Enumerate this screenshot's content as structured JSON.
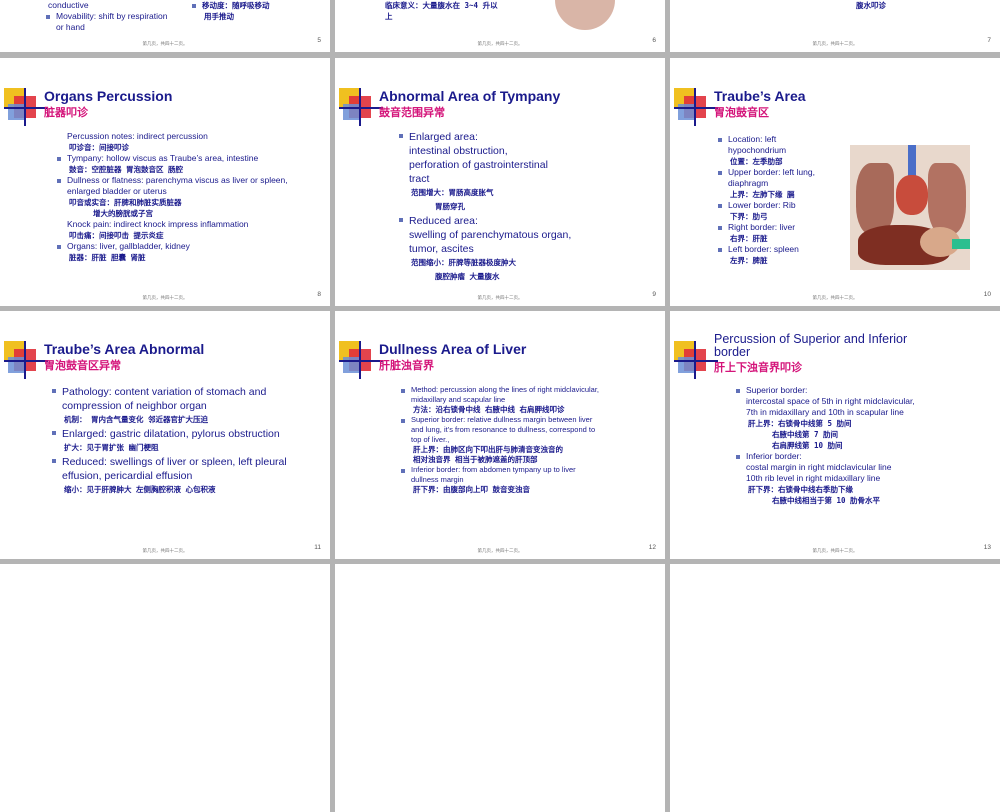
{
  "row0": {
    "s5": {
      "left_lines": [
        "conductive"
      ],
      "bullet": "Movability: shift by respiration or hand",
      "cn_lines": [
        "移动度：随呼吸移动",
        "用手推动"
      ],
      "page": "5"
    },
    "s6": {
      "lines": [
        "临床意义：大量腹水在 3~4 升以",
        "上"
      ],
      "page": "6"
    },
    "s7": {
      "lines": [
        "腹水叩诊"
      ],
      "page": "7"
    }
  },
  "footer_text": "第几页，共四十二页。",
  "s8": {
    "title": "Organs Percussion",
    "subtitle": "脏器叩诊",
    "lines": [
      {
        "t": "Percussion notes: indirect percussion",
        "k": "plain"
      },
      {
        "t": "叩诊音：间接叩诊",
        "k": "cn"
      },
      {
        "t": "Tympany: hollow viscus as Traube’s area, intestine",
        "k": "bullet"
      },
      {
        "t": "鼓音：空腔脏器 胃泡鼓音区 肠腔",
        "k": "cn"
      },
      {
        "t": "Dullness or flatness: parenchyma viscus as liver or spleen, enlarged bladder or uterus",
        "k": "bullet"
      },
      {
        "t": "叩音或实音：肝脾和肺脏实质脏器",
        "k": "cn"
      },
      {
        "t": "增大的膀胱或子宫",
        "k": "cn2"
      },
      {
        "t": "Knock pain: indirect knock impress inflammation",
        "k": "plain"
      },
      {
        "t": "叩击痛：间接叩击 提示炎症",
        "k": "cn"
      },
      {
        "t": "Organs: liver, gallbladder, kidney",
        "k": "bullet"
      },
      {
        "t": "脏器：肝脏 胆囊 肾脏",
        "k": "cn"
      }
    ],
    "page": "8"
  },
  "s9": {
    "title": "Abnormal Area of Tympany",
    "subtitle": "鼓音范围异常",
    "lines": [
      {
        "t": "Enlarged area:",
        "k": "bullet"
      },
      {
        "t": "intestinal obstruction,",
        "k": "plain"
      },
      {
        "t": "perforation of gastrointerstinal",
        "k": "plain"
      },
      {
        "t": "tract",
        "k": "plain"
      },
      {
        "t": "范围增大：胃肠高度胀气",
        "k": "cn"
      },
      {
        "t": "胃肠穿孔",
        "k": "cn2"
      },
      {
        "t": "Reduced area:",
        "k": "bullet"
      },
      {
        "t": "swelling of parenchymatous organ,",
        "k": "plain"
      },
      {
        "t": "tumor, ascites",
        "k": "plain"
      },
      {
        "t": "范围缩小：肝脾等脏器极度肿大",
        "k": "cn"
      },
      {
        "t": "腹腔肿瘤 大量腹水",
        "k": "cn2"
      }
    ],
    "page": "9"
  },
  "s10": {
    "title": "Traube’s Area",
    "subtitle": "胃泡鼓音区",
    "lines": [
      {
        "t": "Location: left hypochondrium",
        "k": "bullet"
      },
      {
        "t": "位置：左季肋部",
        "k": "cn"
      },
      {
        "t": "Upper border: left lung, diaphragm",
        "k": "bullet"
      },
      {
        "t": "上界：左肺下缘 膈",
        "k": "cn"
      },
      {
        "t": "Lower border: Rib",
        "k": "bullet"
      },
      {
        "t": "下界：肋弓",
        "k": "cn"
      },
      {
        "t": "Right border: liver",
        "k": "bullet"
      },
      {
        "t": "右界：肝脏",
        "k": "cn"
      },
      {
        "t": "Left border: spleen",
        "k": "bullet"
      },
      {
        "t": "左界：脾脏",
        "k": "cn"
      }
    ],
    "page": "10"
  },
  "s11": {
    "title": "Traube’s Area  Abnormal",
    "subtitle": "胃泡鼓音区异常",
    "lines": [
      {
        "t": "Pathology: content variation of stomach and compression of neighbor organ",
        "k": "bullet"
      },
      {
        "t": "机制： 胃内含气量变化 邻近器官扩大压迫",
        "k": "cn"
      },
      {
        "t": "Enlarged: gastric dilatation, pylorus obstruction",
        "k": "bullet"
      },
      {
        "t": "扩大：见于胃扩张 幽门梗阻",
        "k": "cn"
      },
      {
        "t": "Reduced: swellings of liver or spleen, left pleural effusion, pericardial effusion",
        "k": "bullet"
      },
      {
        "t": "缩小：见于肝脾肿大 左侧胸腔积液 心包积液",
        "k": "cn"
      }
    ],
    "page": "11"
  },
  "s12": {
    "title": "Dullness Area of Liver",
    "subtitle": "肝脏浊音界",
    "lines": [
      {
        "t": "Method: percussion along the lines of  right midclavicular, midaxillary and scapular line",
        "k": "bullet"
      },
      {
        "t": "方法：沿右锁骨中线 右腋中线 右肩胛线叩诊",
        "k": "cn"
      },
      {
        "t": "Superior border: relative dullness margin between liver and lung, it’s from resonance to dullness, correspond to top of liver.,",
        "k": "bullet"
      },
      {
        "t": "肝上界：由肺区向下叩出肝与肺清音变浊音的",
        "k": "cn"
      },
      {
        "t": "相对浊音界 相当于被肺遮盖的肝顶部",
        "k": "cn"
      },
      {
        "t": "Inferior border: from abdomen tympany up to liver dullness margin",
        "k": "bullet"
      },
      {
        "t": "肝下界：由腹部向上叩 鼓音变浊音",
        "k": "cn"
      }
    ],
    "page": "12"
  },
  "s13": {
    "title": "Percussion of Superior and Inferior border",
    "subtitle": "肝上下浊音界叩诊",
    "lines": [
      {
        "t": "Superior border:",
        "k": "bullet"
      },
      {
        "t": "intercostal space of 5th in right midclavicular,",
        "k": "plain"
      },
      {
        "t": "7th in midaxillary and 10th in scapular line",
        "k": "plain"
      },
      {
        "t": "肝上界：右锁骨中线第 5 肋间",
        "k": "cn"
      },
      {
        "t": "右腋中线第 7 肋间",
        "k": "cn2"
      },
      {
        "t": "右肩胛线第 10 肋间",
        "k": "cn2"
      },
      {
        "t": "Inferior border:",
        "k": "bullet"
      },
      {
        "t": "costal margin in right midclavicular line",
        "k": "plain"
      },
      {
        "t": "10th rib level in right midaxillary line",
        "k": "plain"
      },
      {
        "t": "肝下界：右锁骨中线右季肋下缘",
        "k": "cn"
      },
      {
        "t": "右腋中线相当于第 10 肋骨水平",
        "k": "cn2"
      }
    ],
    "page": "13"
  }
}
